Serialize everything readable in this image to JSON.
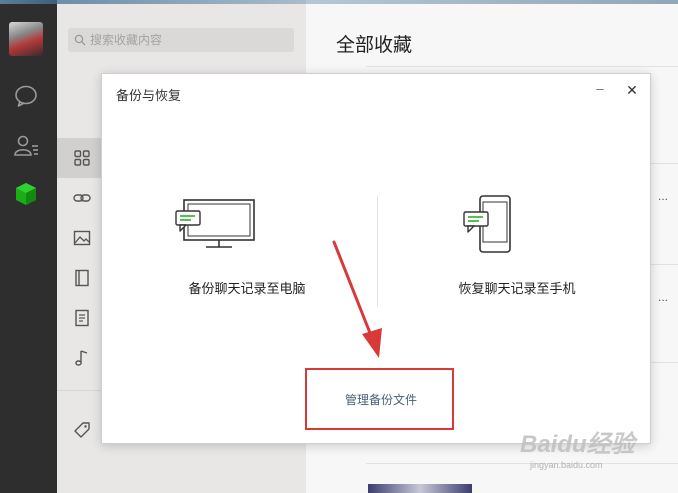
{
  "search": {
    "placeholder": "搜索收藏内容"
  },
  "main": {
    "title": "全部收藏",
    "ellipsis": [
      "...",
      "..."
    ]
  },
  "dialog": {
    "title": "备份与恢复",
    "min_glyph": "–",
    "close_glyph": "✕",
    "backup_label": "备份聊天记录至电脑",
    "restore_label": "恢复聊天记录至手机",
    "manage_label": "管理备份文件"
  },
  "rail": {
    "icons": [
      "avatar",
      "chat-icon",
      "contacts-icon",
      "favorites-cube-icon"
    ]
  },
  "sidebar": {
    "icons": [
      "all-grid-icon",
      "link-icon",
      "image-icon",
      "book-icon",
      "note-icon",
      "music-icon",
      "tag-icon"
    ]
  },
  "watermark": {
    "main": "Baidu经验",
    "sub": "jingyan.baidu.com"
  },
  "colors": {
    "accent_green": "#1aad19",
    "annotation_red": "#d83a3a",
    "link_blue": "#4a5f7a"
  }
}
